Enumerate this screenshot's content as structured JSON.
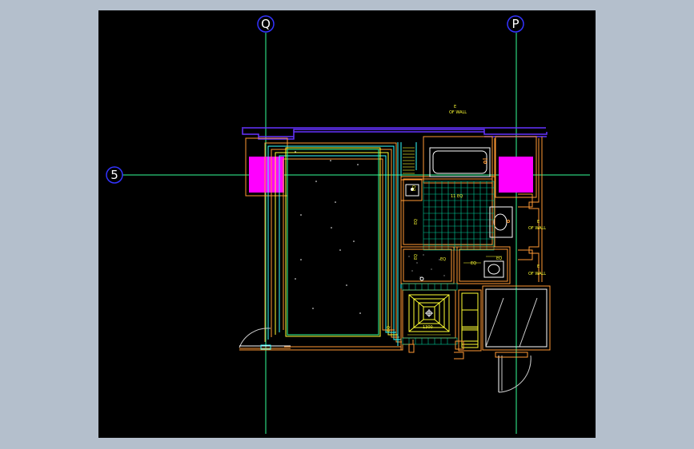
{
  "drawing": {
    "grid_labels": {
      "col_q": "Q",
      "col_p": "P",
      "row_5": "5"
    },
    "annotations": {
      "wall_top": [
        "E",
        "OF WALL"
      ],
      "wall_right_1": [
        "E",
        "OF WALL"
      ],
      "wall_right_2": [
        "E",
        "OF WALL"
      ],
      "bath_dim": "11 EQ",
      "eq_labels": [
        "EQ",
        "EQ",
        "EQ",
        "EQ",
        "EQ",
        "EQ",
        "EQ"
      ],
      "lobby_dim": "1300"
    },
    "colors": {
      "background": "#000000",
      "frame": "#b4bfcc",
      "grid": "#33ff99",
      "grid_bubble": "#3333ff",
      "wall": "#6633ff",
      "column": "#ff00ff",
      "detail": "#ffff33",
      "tile": "#00cc99",
      "orange": "#ff9933",
      "cyan": "#33ffff",
      "white": "#ffffff"
    }
  }
}
